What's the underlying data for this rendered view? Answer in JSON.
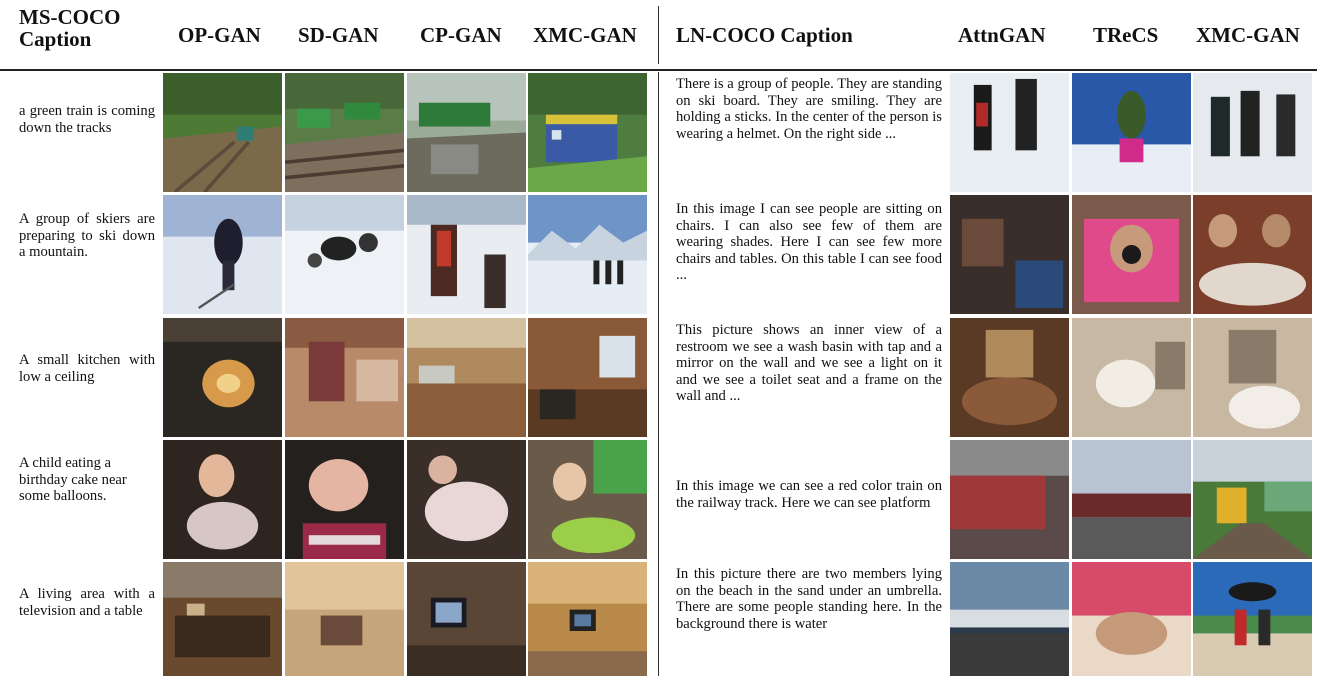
{
  "headers": {
    "left_caption": "MS-COCO Caption",
    "left_methods": [
      "OP-GAN",
      "SD-GAN",
      "CP-GAN",
      "XMC-GAN"
    ],
    "right_caption": "LN-COCO Caption",
    "right_methods": [
      "AttnGAN",
      "TReCS",
      "XMC-GAN"
    ]
  },
  "rows": [
    {
      "mscoco_caption": "a green train is coming down the tracks",
      "lncoco_caption": "There is a group of people. They are standing on ski board. They are smiling. They are holding a sticks. In the center of the person is wearing a helmet. On the right side ..."
    },
    {
      "mscoco_caption": "A group of skiers are preparing to ski down a mountain.",
      "lncoco_caption": "In this image I can see people are sitting on chairs. I can also see few of them are wearing shades. Here I can see few more chairs and tables. On this table I can see food ..."
    },
    {
      "mscoco_caption": "A small kitchen with low a ceiling",
      "lncoco_caption": "This picture shows an inner view of a restroom we see a wash basin with tap and a mirror on the wall and we see a light on it and we see a toilet seat and a frame on the wall and ..."
    },
    {
      "mscoco_caption": "A child eating a birthday cake near some balloons.",
      "lncoco_caption": "In this image we can see a red color train on the railway track. Here we can see platform"
    },
    {
      "mscoco_caption": "A living area with a television and a table",
      "lncoco_caption": "In this picture there are two members lying on the beach in the sand under an umbrella. There are some people standing here. In the background there is water"
    }
  ]
}
